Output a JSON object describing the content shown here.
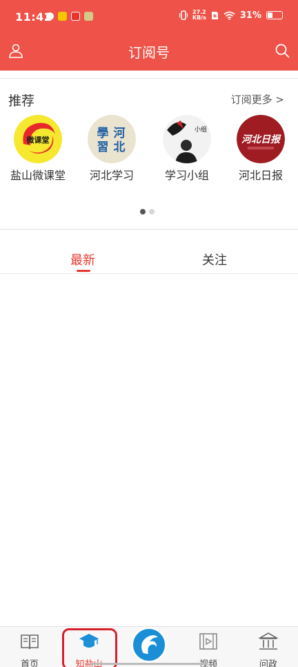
{
  "status_bar": {
    "time": "11:42",
    "net_speed_top": "27.2",
    "net_speed_bottom": "KB/s",
    "battery_percent": "31%",
    "battery_level": 0.31
  },
  "header": {
    "title": "订阅号"
  },
  "recommend": {
    "title": "推荐",
    "more_label": "订阅更多 >",
    "items": [
      {
        "label": "盐山微课堂",
        "avatar_text": "微课堂"
      },
      {
        "label": "河北学习",
        "avatar_text_1": "學",
        "avatar_text_2": "習",
        "avatar_text_3": "河",
        "avatar_text_4": "北"
      },
      {
        "label": "学习小组",
        "avatar_text": "小组"
      },
      {
        "label": "河北日报",
        "avatar_text": "河北日报"
      }
    ],
    "page_count": 2,
    "current_page": 1
  },
  "tabs": {
    "latest": "最新",
    "follow": "关注",
    "active": "最新"
  },
  "bottom_nav": {
    "items": [
      {
        "label": "首页",
        "icon": "book-icon"
      },
      {
        "label": "知盐山",
        "icon": "graduation-cap-icon"
      },
      {
        "label": "",
        "icon": "app-logo-icon"
      },
      {
        "label": "视频",
        "icon": "film-icon"
      },
      {
        "label": "问政",
        "icon": "government-building-icon"
      }
    ],
    "active": "知盐山"
  },
  "colors": {
    "brand_red": "#ee5248",
    "active_red": "#e53a2f",
    "center_blue": "#1a8fd7"
  }
}
